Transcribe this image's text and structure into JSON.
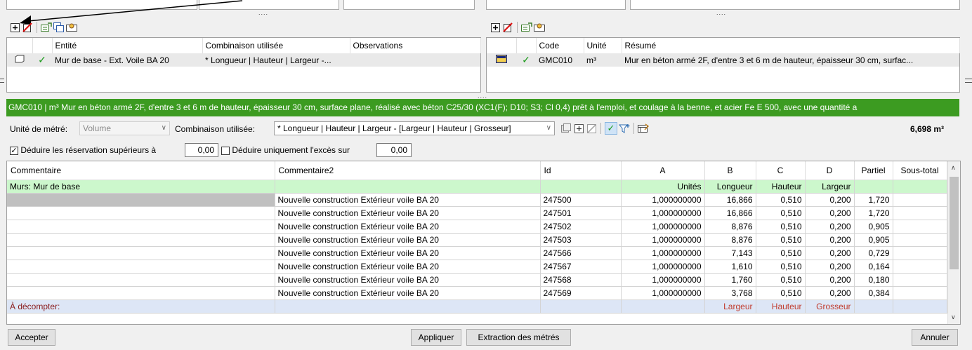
{
  "top_left_panel": {
    "columns": [
      "Entité",
      "Combinaison utilisée",
      "Observations"
    ],
    "rows": [
      {
        "entity": "Mur de base - Ext. Voile BA 20",
        "combination": "* Longueur | Hauteur | Largeur -...",
        "observations": ""
      }
    ]
  },
  "top_right_panel": {
    "columns": [
      "Code",
      "Unité",
      "Résumé"
    ],
    "rows": [
      {
        "code": "GMC010",
        "unit": "m³",
        "summary": "Mur en béton armé 2F, d'entre 3 et 6 m de hauteur, épaisseur 30 cm, surfac..."
      }
    ]
  },
  "dots": "....",
  "green_bar": "GMC010 | m³ Mur en béton armé 2F, d'entre 3 et 6 m de hauteur, épaisseur 30 cm, surface plane, réalisé avec béton C25/30 (XC1(F); D10; S3; Cl 0,4) prêt à l'emploi, et coulage à la benne, et acier Fe E 500, avec une quantité a",
  "options": {
    "unit_label": "Unité de métré:",
    "unit_value": "Volume",
    "combination_label": "Combinaison utilisée:",
    "combination_value": "* Longueur | Hauteur | Largeur - [Largeur | Hauteur | Grosseur]",
    "total": "6,698 m³",
    "deduct_label": "Déduire les réservation supérieurs à",
    "deduct_value": "0,00",
    "deduct_excess_label": "Déduire uniquement l'excès sur",
    "deduct_excess_value": "0,00"
  },
  "table": {
    "headers": [
      "Commentaire",
      "Commentaire2",
      "Id",
      "A",
      "B",
      "C",
      "D",
      "Partiel",
      "Sous-total"
    ],
    "group_row": {
      "comment": "Murs: Mur de base",
      "a": "Unités",
      "b": "Longueur",
      "c": "Hauteur",
      "d": "Largeur"
    },
    "rows": [
      {
        "c2": "Nouvelle construction Extérieur voile BA 20",
        "id": "247500",
        "a": "1,000000000",
        "b": "16,866",
        "c": "0,510",
        "d": "0,200",
        "p": "1,720"
      },
      {
        "c2": "Nouvelle construction Extérieur voile BA 20",
        "id": "247501",
        "a": "1,000000000",
        "b": "16,866",
        "c": "0,510",
        "d": "0,200",
        "p": "1,720"
      },
      {
        "c2": "Nouvelle construction Extérieur voile BA 20",
        "id": "247502",
        "a": "1,000000000",
        "b": "8,876",
        "c": "0,510",
        "d": "0,200",
        "p": "0,905"
      },
      {
        "c2": "Nouvelle construction Extérieur voile BA 20",
        "id": "247503",
        "a": "1,000000000",
        "b": "8,876",
        "c": "0,510",
        "d": "0,200",
        "p": "0,905"
      },
      {
        "c2": "Nouvelle construction Extérieur voile BA 20",
        "id": "247566",
        "a": "1,000000000",
        "b": "7,143",
        "c": "0,510",
        "d": "0,200",
        "p": "0,729"
      },
      {
        "c2": "Nouvelle construction Extérieur voile BA 20",
        "id": "247567",
        "a": "1,000000000",
        "b": "1,610",
        "c": "0,510",
        "d": "0,200",
        "p": "0,164"
      },
      {
        "c2": "Nouvelle construction Extérieur voile BA 20",
        "id": "247568",
        "a": "1,000000000",
        "b": "1,760",
        "c": "0,510",
        "d": "0,200",
        "p": "0,180"
      },
      {
        "c2": "Nouvelle construction Extérieur voile BA 20",
        "id": "247569",
        "a": "1,000000000",
        "b": "3,768",
        "c": "0,510",
        "d": "0,200",
        "p": "0,384"
      }
    ],
    "footer_row": {
      "comment": "À décompter:",
      "b": "Largeur",
      "c": "Hauteur",
      "d": "Grosseur"
    }
  },
  "buttons": {
    "accept": "Accepter",
    "apply": "Appliquer",
    "extract": "Extraction des métrés",
    "cancel": "Annuler"
  },
  "colors": {
    "green_bar": "#3c9b21",
    "group_row": "#ccf7cc",
    "footer_row": "#dde6f6"
  }
}
